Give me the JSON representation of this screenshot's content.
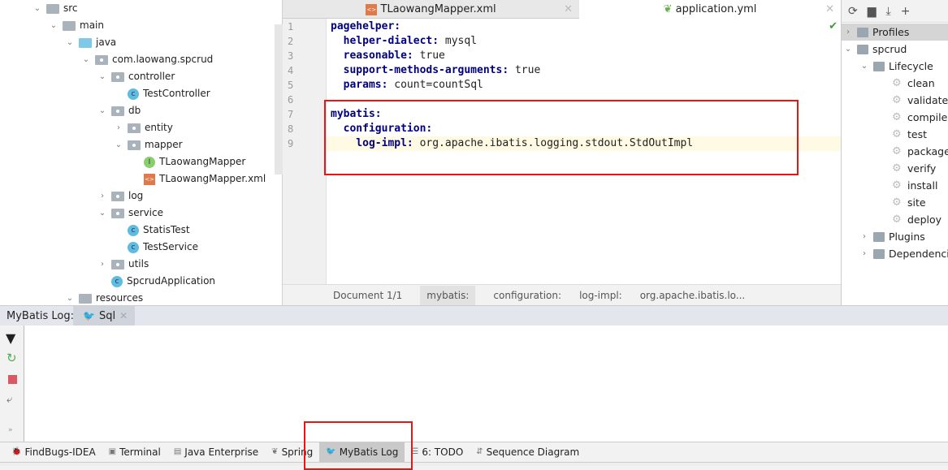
{
  "project_tree": [
    {
      "label": "src",
      "depth": 0,
      "chevron": "down",
      "icon": "folder"
    },
    {
      "label": "main",
      "depth": 1,
      "chevron": "down",
      "icon": "folder"
    },
    {
      "label": "java",
      "depth": 2,
      "chevron": "down",
      "icon": "source-folder"
    },
    {
      "label": "com.laowang.spcrud",
      "depth": 3,
      "chevron": "down",
      "icon": "package"
    },
    {
      "label": "controller",
      "depth": 4,
      "chevron": "down",
      "icon": "package"
    },
    {
      "label": "TestController",
      "depth": 5,
      "chevron": "",
      "icon": "class"
    },
    {
      "label": "db",
      "depth": 4,
      "chevron": "down",
      "icon": "package"
    },
    {
      "label": "entity",
      "depth": 5,
      "chevron": "right",
      "icon": "package"
    },
    {
      "label": "mapper",
      "depth": 5,
      "chevron": "down",
      "icon": "package"
    },
    {
      "label": "TLaowangMapper",
      "depth": 6,
      "chevron": "",
      "icon": "interface"
    },
    {
      "label": "TLaowangMapper.xml",
      "depth": 6,
      "chevron": "",
      "icon": "xml"
    },
    {
      "label": "log",
      "depth": 4,
      "chevron": "right",
      "icon": "package"
    },
    {
      "label": "service",
      "depth": 4,
      "chevron": "down",
      "icon": "package"
    },
    {
      "label": "StatisTest",
      "depth": 5,
      "chevron": "",
      "icon": "class"
    },
    {
      "label": "TestService",
      "depth": 5,
      "chevron": "",
      "icon": "class"
    },
    {
      "label": "utils",
      "depth": 4,
      "chevron": "right",
      "icon": "package"
    },
    {
      "label": "SpcrudApplication",
      "depth": 4,
      "chevron": "",
      "icon": "spring-class"
    },
    {
      "label": "resources",
      "depth": 2,
      "chevron": "down",
      "icon": "resources-folder"
    }
  ],
  "editor": {
    "tabs": [
      {
        "label": "TLaowangMapper.xml",
        "active": false
      },
      {
        "label": "application.yml",
        "active": true
      }
    ],
    "lines": [
      {
        "n": "1",
        "key": "pagehelper:",
        "val": ""
      },
      {
        "n": "2",
        "key": "  helper-dialect:",
        "val": " mysql"
      },
      {
        "n": "3",
        "key": "  reasonable:",
        "val": " true"
      },
      {
        "n": "4",
        "key": "  support-methods-arguments:",
        "val": " true"
      },
      {
        "n": "5",
        "key": "  params:",
        "val": " count=countSql"
      },
      {
        "n": "6",
        "key": "",
        "val": ""
      },
      {
        "n": "7",
        "key": "mybatis:",
        "val": ""
      },
      {
        "n": "8",
        "key": "  configuration:",
        "val": ""
      },
      {
        "n": "9",
        "key": "    log-impl:",
        "val": " org.apache.ibatis.logging.stdout.StdOutImpl"
      }
    ],
    "breadcrumbs": [
      "Document 1/1",
      "mybatis:",
      "configuration:",
      "log-impl:",
      "org.apache.ibatis.lo..."
    ]
  },
  "maven": {
    "items": [
      {
        "label": "Profiles",
        "depth": 0,
        "chevron": "right"
      },
      {
        "label": "spcrud",
        "depth": 0,
        "chevron": "down"
      },
      {
        "label": "Lifecycle",
        "depth": 1,
        "chevron": "down"
      },
      {
        "label": "clean",
        "depth": 2,
        "chevron": ""
      },
      {
        "label": "validate",
        "depth": 2,
        "chevron": ""
      },
      {
        "label": "compile",
        "depth": 2,
        "chevron": ""
      },
      {
        "label": "test",
        "depth": 2,
        "chevron": ""
      },
      {
        "label": "package",
        "depth": 2,
        "chevron": ""
      },
      {
        "label": "verify",
        "depth": 2,
        "chevron": ""
      },
      {
        "label": "install",
        "depth": 2,
        "chevron": ""
      },
      {
        "label": "site",
        "depth": 2,
        "chevron": ""
      },
      {
        "label": "deploy",
        "depth": 2,
        "chevron": ""
      },
      {
        "label": "Plugins",
        "depth": 1,
        "chevron": "right"
      },
      {
        "label": "Dependencies",
        "depth": 1,
        "chevron": "right"
      }
    ]
  },
  "mybatis_log": {
    "title": "MyBatis Log:",
    "tab": "Sql"
  },
  "bottom_tools": [
    {
      "label": "FindBugs-IDEA",
      "icon": "bug-icon"
    },
    {
      "label": "Terminal",
      "icon": "terminal-icon"
    },
    {
      "label": "Java Enterprise",
      "icon": "java-enterprise-icon"
    },
    {
      "label": "Spring",
      "icon": "spring-icon"
    },
    {
      "label": "MyBatis Log",
      "icon": "mybatis-icon",
      "active": true
    },
    {
      "label": "6: TODO",
      "icon": "todo-icon"
    },
    {
      "label": "Sequence Diagram",
      "icon": "sequence-diagram-icon"
    }
  ],
  "colors": {
    "highlight_box": "#e01818",
    "keyword": "#000080"
  }
}
